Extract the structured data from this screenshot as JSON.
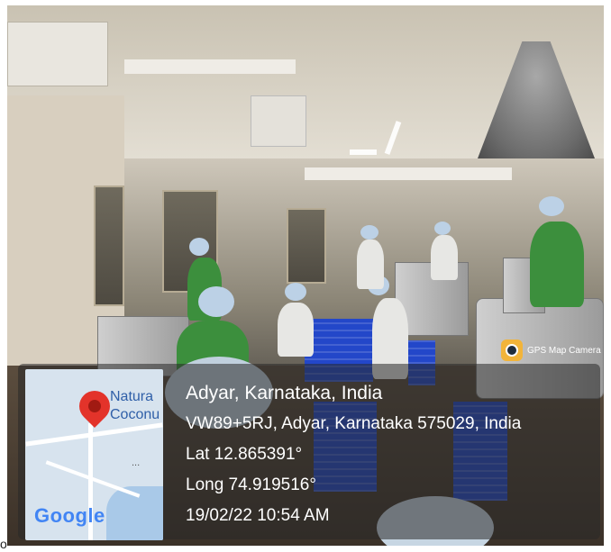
{
  "location": {
    "title": "Adyar, Karnataka, India",
    "address": "VW89+5RJ, Adyar, Karnataka 575029, India",
    "lat": "Lat 12.865391°",
    "long": "Long 74.919516°",
    "datetime": "19/02/22 10:54 AM"
  },
  "badge": {
    "text": "GPS Map Camera",
    "icon": "camera-icon"
  },
  "map": {
    "label_1": "Natura",
    "label_2": "Coconu",
    "brand": "Google",
    "dots": "...",
    "pin_icon": "map-pin-icon",
    "pin_color": "#e3332a"
  },
  "edge_mark": "o"
}
